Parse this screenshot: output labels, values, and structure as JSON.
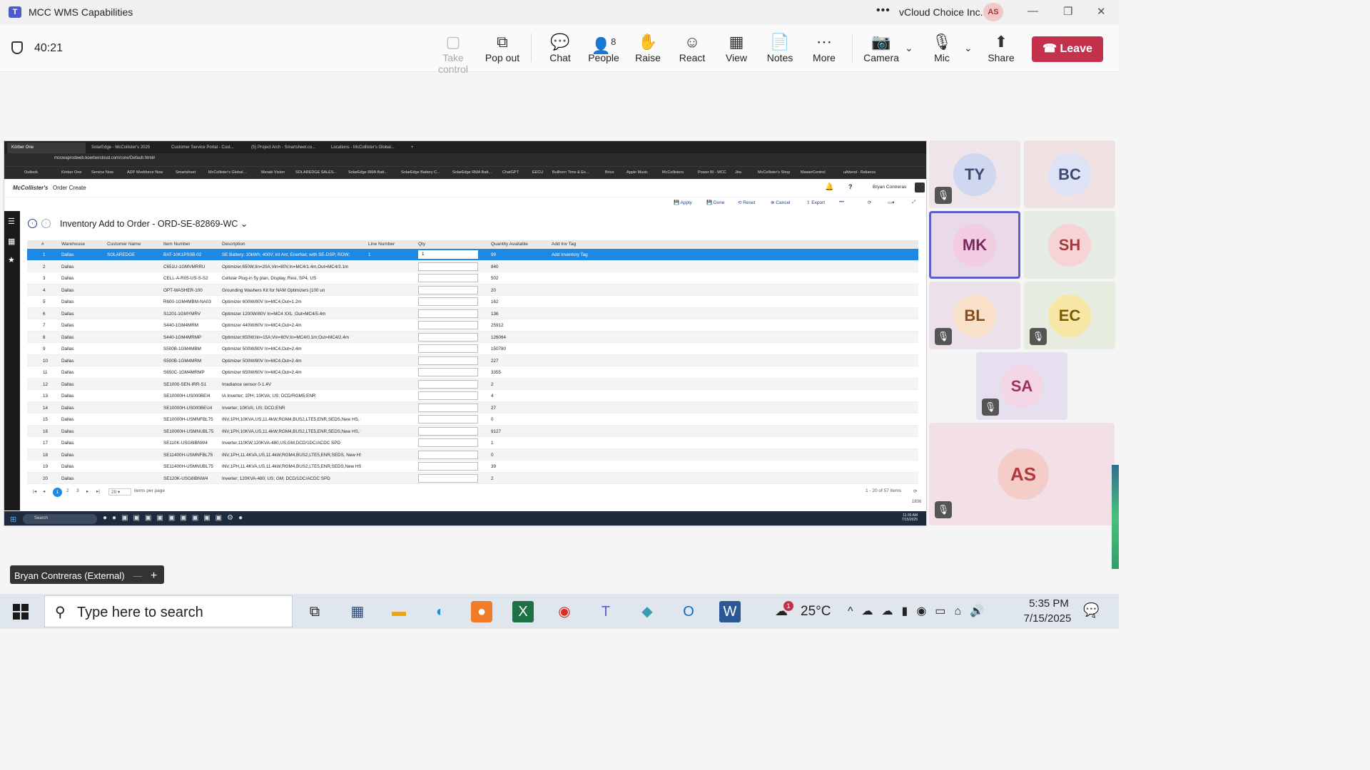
{
  "teams": {
    "title": "MCC WMS Capabilities",
    "org": "vCloud Choice Inc.",
    "user_initials": "AS",
    "timer": "40:21",
    "toolbar": {
      "take_control": "Take control",
      "pop_out": "Pop out",
      "chat": "Chat",
      "people": "People",
      "people_count": "8",
      "raise": "Raise",
      "react": "React",
      "view": "View",
      "notes": "Notes",
      "more": "More",
      "camera": "Camera",
      "mic": "Mic",
      "share": "Share",
      "leave": "Leave"
    },
    "participants": [
      "TY",
      "BC",
      "MK",
      "SH",
      "BL",
      "EC",
      "SA",
      "AS"
    ],
    "presenter_label": "Bryan Contreras (External)"
  },
  "browser": {
    "tabs": [
      "Körber One",
      "SolarEdge - McCollister's 2025",
      "Customer Service Portal - Cust...",
      "(5) Project Arch - Smartsheet.co...",
      "Locations - McCollister's Global..."
    ],
    "url": "mccwaprodweb.koerbercloud.com/core/Default.html#",
    "bookmarks": [
      "Outlook",
      "Körber One",
      "Service Now",
      "ADP Workforce Now",
      "Smartsheet",
      "McCollister's Global...",
      "Meraki Vision",
      "SOLAREDGE SALES...",
      "SolarEdge RMA Batt...",
      "SolarEdge Battery C...",
      "SolarEdge RMA Batt...",
      "ChatGPT",
      "EECU",
      "Bullhorn Time & Ex...",
      "Brivo",
      "Apple Music",
      "McCollisters",
      "Power BI - MCC",
      "Jira",
      "McCollister's Shop",
      "MasterControl",
      "uAttend - Reliance"
    ]
  },
  "app": {
    "logo": "McCollister's",
    "nav": "Order Create",
    "user": "Bryan Contreras",
    "actions": [
      "Apply",
      "Done",
      "Reset",
      "Cancel",
      "Export"
    ],
    "page_title": "Inventory Add to Order - ORD-SE-82869-WC",
    "columns": [
      "#",
      "Warehouse",
      "Customer Name",
      "Item Number",
      "Description",
      "Line Number",
      "Qty",
      "Quantity Available",
      "Add Inv Tag"
    ],
    "rows": [
      {
        "n": "1",
        "wh": "Dallas",
        "cust": "SOLAREDGE",
        "item": "BAT-10K1PS0B-02",
        "desc": "SE Battery; 10kWh; 400V; int Ant; EnerNet; with SE-DSP; ROW;",
        "line": "1",
        "qty": "1",
        "avail": "99",
        "tag": "Add Inventory Tag"
      },
      {
        "n": "2",
        "wh": "Dallas",
        "cust": "",
        "item": "C651U-1GMVMRRU",
        "desc": "Optimizer,650W,Iin=20A,Vin=80V,In=MC4/1.4m,Out=MC4/3.1m",
        "line": "",
        "qty": "",
        "avail": "840",
        "tag": ""
      },
      {
        "n": "3",
        "wh": "Dallas",
        "cust": "",
        "item": "CELL-A-R05-US-S-S2",
        "desc": "Cellular Plug-in 5y plan, Display, Resi, SP4, US",
        "line": "",
        "qty": "",
        "avail": "502",
        "tag": ""
      },
      {
        "n": "4",
        "wh": "Dallas",
        "cust": "",
        "item": "OPT-WASHER-100",
        "desc": "Grounding Washers Kit for NAM Optimizers [100 un",
        "line": "",
        "qty": "",
        "avail": "20",
        "tag": ""
      },
      {
        "n": "5",
        "wh": "Dallas",
        "cust": "",
        "item": "R600-1GM4MBM-NA03",
        "desc": "Optimizer 600W/80V In=MC4,Out=1.2m",
        "line": "",
        "qty": "",
        "avail": "162",
        "tag": ""
      },
      {
        "n": "6",
        "wh": "Dallas",
        "cust": "",
        "item": "S1201-1GMYMRV",
        "desc": "Optimizer 1200W/80V In=MC4 XXL ;Out=MC4/5.4m",
        "line": "",
        "qty": "",
        "avail": "136",
        "tag": ""
      },
      {
        "n": "7",
        "wh": "Dallas",
        "cust": "",
        "item": "S440-1GM4MRM",
        "desc": "Optimizer 440W/60V In=MC4,Out=2.4m",
        "line": "",
        "qty": "",
        "avail": "25912",
        "tag": ""
      },
      {
        "n": "8",
        "wh": "Dallas",
        "cust": "",
        "item": "S440-1GM4MRMP",
        "desc": "Optimizer;650W;Iin=15A;Vin=60V;In=MC4/0.1m;Out=MC4/2.4m",
        "line": "",
        "qty": "",
        "avail": "126064",
        "tag": ""
      },
      {
        "n": "9",
        "wh": "Dallas",
        "cust": "",
        "item": "S500B-1GM4MBM",
        "desc": "Optimizer 500W/80V In=MC4,Out=2.4m",
        "line": "",
        "qty": "",
        "avail": "150780",
        "tag": ""
      },
      {
        "n": "10",
        "wh": "Dallas",
        "cust": "",
        "item": "S500B-1GM4MRM",
        "desc": "Optimizer 500W/80V In=MC4,Out=2.4m",
        "line": "",
        "qty": "",
        "avail": "227",
        "tag": ""
      },
      {
        "n": "11",
        "wh": "Dallas",
        "cust": "",
        "item": "S650C-1GM4MRMP",
        "desc": "Optimizer 650W/60V In=MC4,Out=2.4m",
        "line": "",
        "qty": "",
        "avail": "3355",
        "tag": ""
      },
      {
        "n": "12",
        "wh": "Dallas",
        "cust": "",
        "item": "SE1000-SEN-IRR-S1",
        "desc": "Irradiance sensor 0-1.4V",
        "line": "",
        "qty": "",
        "avail": "2",
        "tag": ""
      },
      {
        "n": "13",
        "wh": "Dallas",
        "cust": "",
        "item": "SE10000H-US000BEI4",
        "desc": "IA Inverter; 1PH; 10KVA; US; DCD/RGM5;ENR",
        "line": "",
        "qty": "",
        "avail": "4",
        "tag": ""
      },
      {
        "n": "14",
        "wh": "Dallas",
        "cust": "",
        "item": "SE10000H-US000BEU4",
        "desc": "Inverter; 10KVA; US; DCD;ENR",
        "line": "",
        "qty": "",
        "avail": "27",
        "tag": ""
      },
      {
        "n": "15",
        "wh": "Dallas",
        "cust": "",
        "item": "SE10000H-USMNFBL75",
        "desc": "INV,1PH,10KVA,US,11.4kW,RGM4,BUS2,LTE5,ENR,SEDS,New HS, Par",
        "line": "",
        "qty": "",
        "avail": "0",
        "tag": ""
      },
      {
        "n": "16",
        "wh": "Dallas",
        "cust": "",
        "item": "SE10000H-USMNUBL75",
        "desc": "INV,1PH,10KVA,US,11.4kW,RGM4,BUS2,LTE5,ENR,SEDS,New HS, Part",
        "line": "",
        "qty": "",
        "avail": "9127",
        "tag": ""
      },
      {
        "n": "17",
        "wh": "Dallas",
        "cust": "",
        "item": "SE110K-USG8IBNW4",
        "desc": "Inverter,110KW,120KVA-480,US,GM,DCD/1DC/ACDC SPD",
        "line": "",
        "qty": "",
        "avail": "1",
        "tag": ""
      },
      {
        "n": "18",
        "wh": "Dallas",
        "cust": "",
        "item": "SE11400H-USMNFBL75",
        "desc": "INV,1PH,11.4KVA,US,11.4kW,RGM4,BUS2,LTE5,ENR,SEDS, New HS, P",
        "line": "",
        "qty": "",
        "avail": "0",
        "tag": ""
      },
      {
        "n": "19",
        "wh": "Dallas",
        "cust": "",
        "item": "SE11400H-USMNUBL75",
        "desc": "INV,1PH,11.4KVA,US,11.4kW,RGM4,BUS2,LTE5,ENR,SEDS,New HS, Pa",
        "line": "",
        "qty": "",
        "avail": "39",
        "tag": ""
      },
      {
        "n": "20",
        "wh": "Dallas",
        "cust": "",
        "item": "SE120K-USG8IBNW4",
        "desc": "Inverter; 120KVA-480; US; GM; DCD/1DC/ACDC SPD",
        "line": "",
        "qty": "",
        "avail": "2",
        "tag": ""
      }
    ],
    "pager": {
      "pages": [
        "1",
        "2",
        "3"
      ],
      "page_size": "20",
      "items_per_page": "items per page",
      "range": "1 - 20 of 57 items",
      "count": "1836"
    }
  },
  "inner_taskbar": {
    "search": "Search",
    "time": "11:35 AM",
    "date": "7/15/2025"
  },
  "windows_taskbar": {
    "search_placeholder": "Type here to search",
    "temperature": "25°C",
    "weather_badge": "1",
    "time": "5:35 PM",
    "date": "7/15/2025",
    "notifications": "4"
  }
}
